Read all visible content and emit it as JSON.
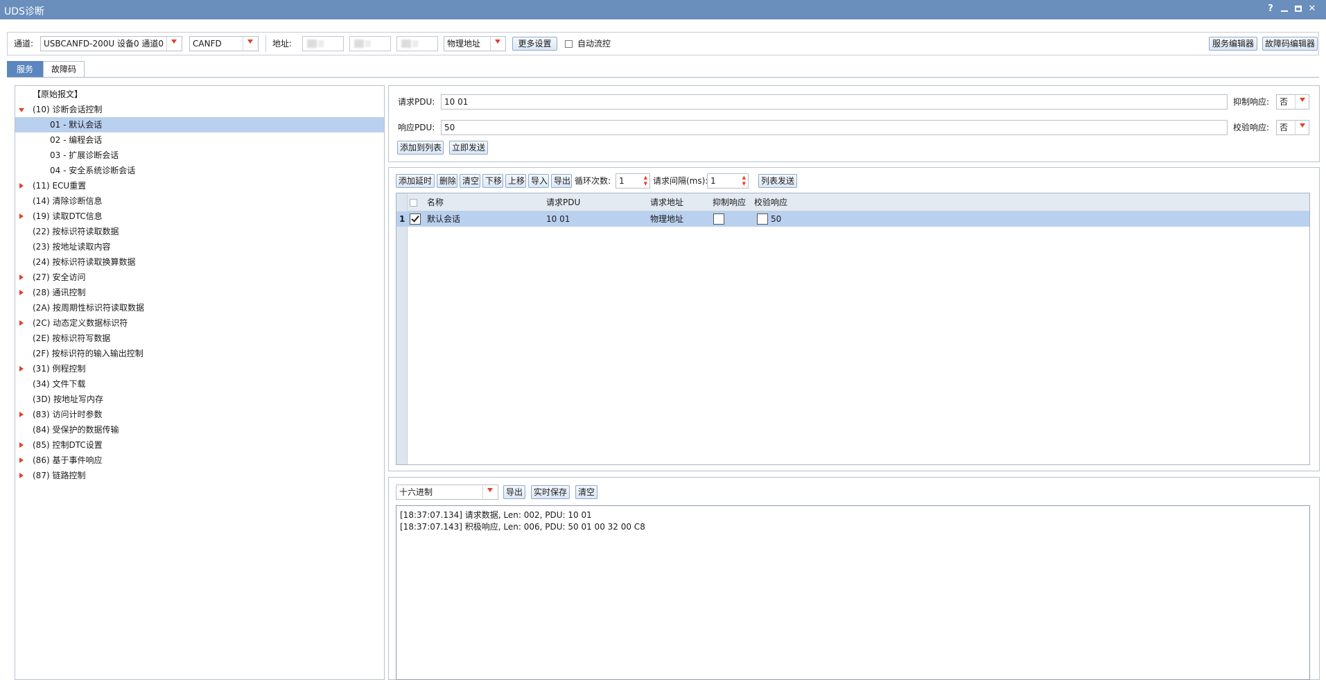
{
  "window": {
    "title": "UDS诊断"
  },
  "toolbar": {
    "channel_label": "通道:",
    "channel_value": "USBCANFD-200U 设备0 通道0",
    "protocol_value": "CANFD",
    "address_label": "地址:",
    "address_type_value": "物理地址",
    "more_settings": "更多设置",
    "auto_flow_label": "自动流控",
    "service_editor": "服务编辑器",
    "dtc_editor": "故障码编辑器"
  },
  "tabs": [
    {
      "label": "服务",
      "active": true
    },
    {
      "label": "故障码",
      "active": false
    }
  ],
  "tree": [
    {
      "label": "【原始报文】",
      "level": 0,
      "expander": "none",
      "selected": false
    },
    {
      "label": "(10) 诊断会话控制",
      "level": 0,
      "expander": "down",
      "selected": false
    },
    {
      "label": "01 - 默认会话",
      "level": 1,
      "expander": "none",
      "selected": true
    },
    {
      "label": "02 - 编程会话",
      "level": 1,
      "expander": "none",
      "selected": false
    },
    {
      "label": "03 - 扩展诊断会话",
      "level": 1,
      "expander": "none",
      "selected": false
    },
    {
      "label": "04 - 安全系统诊断会话",
      "level": 1,
      "expander": "none",
      "selected": false
    },
    {
      "label": "(11) ECU重置",
      "level": 0,
      "expander": "right",
      "selected": false
    },
    {
      "label": "(14) 清除诊断信息",
      "level": 0,
      "expander": "none",
      "selected": false
    },
    {
      "label": "(19) 读取DTC信息",
      "level": 0,
      "expander": "right",
      "selected": false
    },
    {
      "label": "(22) 按标识符读取数据",
      "level": 0,
      "expander": "none",
      "selected": false
    },
    {
      "label": "(23) 按地址读取内容",
      "level": 0,
      "expander": "none",
      "selected": false
    },
    {
      "label": "(24) 按标识符读取换算数据",
      "level": 0,
      "expander": "none",
      "selected": false
    },
    {
      "label": "(27) 安全访问",
      "level": 0,
      "expander": "right",
      "selected": false
    },
    {
      "label": "(28) 通讯控制",
      "level": 0,
      "expander": "right",
      "selected": false
    },
    {
      "label": "(2A) 按周期性标识符读取数据",
      "level": 0,
      "expander": "none",
      "selected": false
    },
    {
      "label": "(2C) 动态定义数据标识符",
      "level": 0,
      "expander": "right",
      "selected": false
    },
    {
      "label": "(2E) 按标识符写数据",
      "level": 0,
      "expander": "none",
      "selected": false
    },
    {
      "label": "(2F) 按标识符的输入输出控制",
      "level": 0,
      "expander": "none",
      "selected": false
    },
    {
      "label": "(31) 例程控制",
      "level": 0,
      "expander": "right",
      "selected": false
    },
    {
      "label": "(34) 文件下载",
      "level": 0,
      "expander": "none",
      "selected": false
    },
    {
      "label": "(3D) 按地址写内存",
      "level": 0,
      "expander": "none",
      "selected": false
    },
    {
      "label": "(83) 访问计时参数",
      "level": 0,
      "expander": "right",
      "selected": false
    },
    {
      "label": "(84) 受保护的数据传输",
      "level": 0,
      "expander": "none",
      "selected": false
    },
    {
      "label": "(85) 控制DTC设置",
      "level": 0,
      "expander": "right",
      "selected": false
    },
    {
      "label": "(86) 基于事件响应",
      "level": 0,
      "expander": "right",
      "selected": false
    },
    {
      "label": "(87) 链路控制",
      "level": 0,
      "expander": "right",
      "selected": false
    }
  ],
  "request": {
    "req_label": "请求PDU:",
    "req_value": "10 01",
    "suppress_label": "抑制响应:",
    "suppress_value": "否",
    "resp_label": "响应PDU:",
    "resp_value": "50",
    "verify_label": "校验响应:",
    "verify_value": "否",
    "add_to_list": "添加到列表",
    "send_now": "立即发送"
  },
  "list_toolbar": {
    "add_delay": "添加延时",
    "delete": "删除",
    "clear": "清空",
    "move_down": "下移",
    "move_up": "上移",
    "import": "导入",
    "export": "导出",
    "loop_label": "循环次数:",
    "loop_value": "1",
    "interval_label": "请求间隔(ms):",
    "interval_value": "1",
    "list_send": "列表发送"
  },
  "grid": {
    "columns": [
      "名称",
      "请求PDU",
      "请求地址",
      "抑制响应",
      "校验响应"
    ],
    "rows": [
      {
        "index": "1",
        "checked": true,
        "name": "默认会话",
        "pdu": "10 01",
        "address": "物理地址",
        "suppress": false,
        "verify": false,
        "verify_value": "50"
      }
    ]
  },
  "log_toolbar": {
    "format_value": "十六进制",
    "export": "导出",
    "realtime_save": "实时保存",
    "clear": "清空"
  },
  "log": [
    "[18:37:07.134] 请求数据, Len: 002, PDU: 10 01",
    "[18:37:07.143] 积极响应, Len: 006, PDU: 50 01 00 32 00 C8"
  ]
}
